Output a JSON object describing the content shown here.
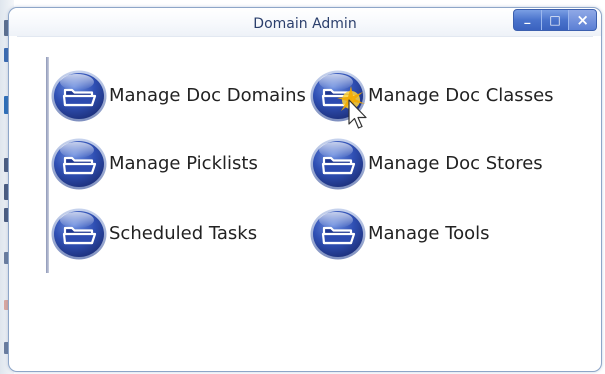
{
  "window": {
    "title": "Domain Admin",
    "buttons": [
      {
        "name": "minimize",
        "glyph": "_"
      },
      {
        "name": "maximize",
        "glyph": "□"
      },
      {
        "name": "close",
        "glyph": "×"
      }
    ]
  },
  "menu": {
    "items": [
      {
        "id": "manage-doc-domains",
        "label": "Manage Doc Domains",
        "icon": "folder-icon"
      },
      {
        "id": "manage-doc-classes",
        "label": "Manage Doc Classes",
        "icon": "folder-icon"
      },
      {
        "id": "manage-picklists",
        "label": "Manage Picklists",
        "icon": "folder-icon"
      },
      {
        "id": "manage-doc-stores",
        "label": "Manage Doc Stores",
        "icon": "folder-icon"
      },
      {
        "id": "scheduled-tasks",
        "label": "Scheduled Tasks",
        "icon": "folder-icon"
      },
      {
        "id": "manage-tools",
        "label": "Manage Tools",
        "icon": "folder-icon"
      }
    ]
  },
  "colors": {
    "accent": "#3a5bb8",
    "title_text": "#2b3f6c",
    "window_border": "#8ea6c8",
    "button_blue": "#4a73cc"
  },
  "cursor": {
    "icon": "mouse-pointer-icon",
    "highlight": "click-spark-icon"
  }
}
